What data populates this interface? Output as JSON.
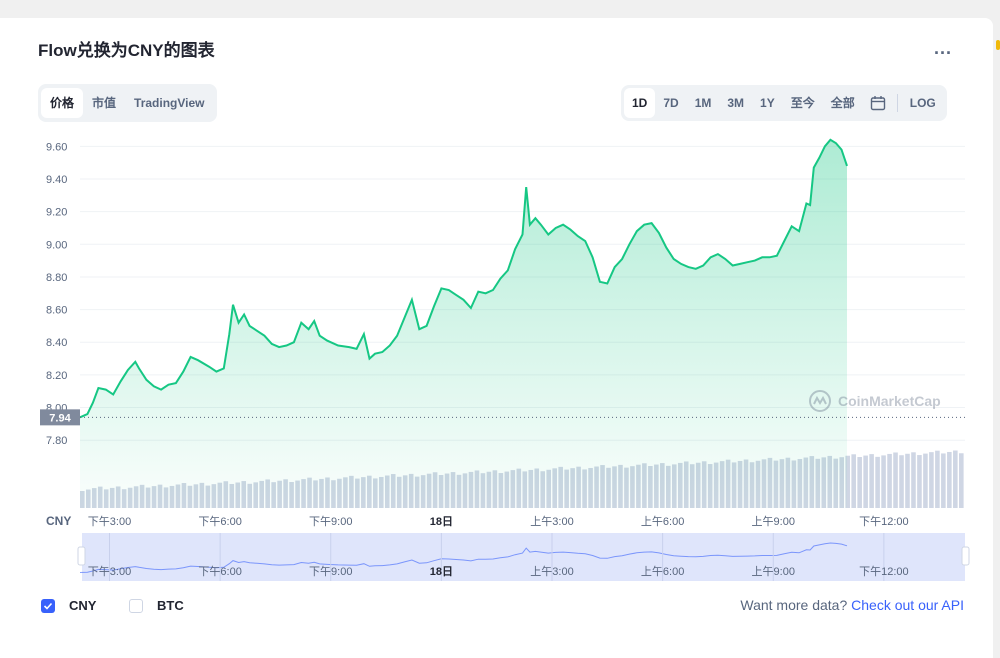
{
  "header": {
    "title": "Flow兑换为CNY的图表",
    "more": "..."
  },
  "view_tabs": [
    {
      "label": "价格",
      "active": true
    },
    {
      "label": "市值",
      "active": false
    },
    {
      "label": "TradingView",
      "active": false
    }
  ],
  "range_tabs": [
    {
      "label": "1D",
      "active": true
    },
    {
      "label": "7D",
      "active": false
    },
    {
      "label": "1M",
      "active": false
    },
    {
      "label": "3M",
      "active": false
    },
    {
      "label": "1Y",
      "active": false
    },
    {
      "label": "至今",
      "active": false
    },
    {
      "label": "全部",
      "active": false
    }
  ],
  "log_label": "LOG",
  "icons": {
    "calendar": "calendar-icon",
    "watermark": "coinmarketcap-logo"
  },
  "watermark_text": "CoinMarketCap",
  "colors": {
    "line": "#16c784",
    "accent": "#3861fb",
    "price_tag": "#808a9d",
    "navigator": "#dfe5fb"
  },
  "chart_data": {
    "type": "area",
    "currency_axis_label": "CNY",
    "y_ticks": [
      7.8,
      8.0,
      8.2,
      8.4,
      8.6,
      8.8,
      9.0,
      9.2,
      9.4,
      9.6
    ],
    "ylim": [
      7.74,
      9.7
    ],
    "current_price_tag": "7.94",
    "x_tick_labels": [
      "下午3:00",
      "下午6:00",
      "下午9:00",
      "18日",
      "上午3:00",
      "上午6:00",
      "上午9:00",
      "下午12:00"
    ],
    "x_range_hours": [
      0,
      24
    ],
    "x_tick_hours": [
      0.8,
      3.8,
      6.8,
      9.8,
      12.8,
      15.8,
      18.8,
      21.8
    ],
    "bold_tick": "18日",
    "series": [
      {
        "values": [
          [
            0.0,
            7.94
          ],
          [
            0.2,
            7.96
          ],
          [
            0.35,
            8.03
          ],
          [
            0.5,
            8.12
          ],
          [
            0.7,
            8.11
          ],
          [
            0.9,
            8.08
          ],
          [
            1.1,
            8.16
          ],
          [
            1.3,
            8.23
          ],
          [
            1.5,
            8.28
          ],
          [
            1.6,
            8.24
          ],
          [
            1.8,
            8.17
          ],
          [
            2.0,
            8.13
          ],
          [
            2.2,
            8.11
          ],
          [
            2.4,
            8.14
          ],
          [
            2.6,
            8.15
          ],
          [
            2.8,
            8.22
          ],
          [
            3.0,
            8.31
          ],
          [
            3.2,
            8.29
          ],
          [
            3.5,
            8.25
          ],
          [
            3.7,
            8.22
          ],
          [
            3.9,
            8.24
          ],
          [
            4.05,
            8.45
          ],
          [
            4.15,
            8.63
          ],
          [
            4.3,
            8.52
          ],
          [
            4.45,
            8.57
          ],
          [
            4.6,
            8.5
          ],
          [
            4.8,
            8.47
          ],
          [
            5.0,
            8.44
          ],
          [
            5.2,
            8.39
          ],
          [
            5.4,
            8.37
          ],
          [
            5.6,
            8.38
          ],
          [
            5.8,
            8.4
          ],
          [
            6.0,
            8.52
          ],
          [
            6.2,
            8.48
          ],
          [
            6.35,
            8.53
          ],
          [
            6.5,
            8.44
          ],
          [
            6.7,
            8.41
          ],
          [
            7.0,
            8.38
          ],
          [
            7.3,
            8.37
          ],
          [
            7.5,
            8.36
          ],
          [
            7.7,
            8.45
          ],
          [
            7.85,
            8.3
          ],
          [
            8.0,
            8.33
          ],
          [
            8.2,
            8.34
          ],
          [
            8.4,
            8.38
          ],
          [
            8.6,
            8.44
          ],
          [
            8.8,
            8.55
          ],
          [
            9.0,
            8.66
          ],
          [
            9.2,
            8.48
          ],
          [
            9.4,
            8.5
          ],
          [
            9.6,
            8.62
          ],
          [
            9.8,
            8.73
          ],
          [
            10.0,
            8.72
          ],
          [
            10.2,
            8.69
          ],
          [
            10.4,
            8.66
          ],
          [
            10.6,
            8.61
          ],
          [
            10.8,
            8.71
          ],
          [
            11.0,
            8.7
          ],
          [
            11.2,
            8.72
          ],
          [
            11.4,
            8.79
          ],
          [
            11.6,
            8.84
          ],
          [
            11.8,
            8.97
          ],
          [
            12.0,
            9.06
          ],
          [
            12.1,
            9.35
          ],
          [
            12.2,
            9.12
          ],
          [
            12.35,
            9.16
          ],
          [
            12.5,
            9.12
          ],
          [
            12.7,
            9.06
          ],
          [
            12.9,
            9.1
          ],
          [
            13.1,
            9.12
          ],
          [
            13.3,
            9.09
          ],
          [
            13.5,
            9.05
          ],
          [
            13.7,
            9.02
          ],
          [
            13.9,
            8.92
          ],
          [
            14.1,
            8.77
          ],
          [
            14.3,
            8.76
          ],
          [
            14.5,
            8.86
          ],
          [
            14.7,
            8.91
          ],
          [
            14.9,
            9.0
          ],
          [
            15.1,
            9.08
          ],
          [
            15.3,
            9.12
          ],
          [
            15.5,
            9.13
          ],
          [
            15.7,
            9.07
          ],
          [
            15.9,
            8.98
          ],
          [
            16.1,
            8.91
          ],
          [
            16.3,
            8.88
          ],
          [
            16.5,
            8.86
          ],
          [
            16.7,
            8.85
          ],
          [
            16.9,
            8.87
          ],
          [
            17.1,
            8.92
          ],
          [
            17.3,
            8.94
          ],
          [
            17.5,
            8.91
          ],
          [
            17.7,
            8.87
          ],
          [
            17.9,
            8.88
          ],
          [
            18.1,
            8.89
          ],
          [
            18.3,
            8.9
          ],
          [
            18.5,
            8.92
          ],
          [
            18.7,
            8.92
          ],
          [
            18.9,
            8.93
          ],
          [
            19.1,
            9.02
          ],
          [
            19.3,
            9.11
          ],
          [
            19.5,
            9.08
          ],
          [
            19.7,
            9.25
          ],
          [
            19.8,
            9.24
          ],
          [
            19.9,
            9.47
          ],
          [
            20.05,
            9.53
          ],
          [
            20.2,
            9.6
          ],
          [
            20.35,
            9.64
          ],
          [
            20.5,
            9.62
          ],
          [
            20.65,
            9.58
          ],
          [
            20.8,
            9.48
          ]
        ]
      }
    ],
    "volume_note": "bars",
    "grid": true
  },
  "checkboxes": [
    {
      "label": "CNY",
      "checked": true
    },
    {
      "label": "BTC",
      "checked": false
    }
  ],
  "footer": {
    "prefix": "Want more data?",
    "link": "Check out our API"
  }
}
